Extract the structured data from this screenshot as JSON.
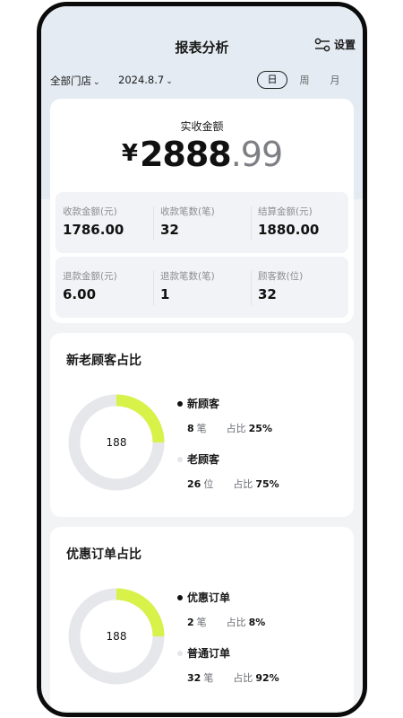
{
  "header": {
    "title": "报表分析",
    "settings_label": "设置"
  },
  "filters": {
    "store": "全部门店",
    "date": "2024.8.7",
    "periods": [
      "日",
      "周",
      "月"
    ],
    "selected_period": "日"
  },
  "summary": {
    "label": "实收金额",
    "currency": "¥",
    "amount_int": "2888",
    "amount_dec": ".99"
  },
  "stats_row1": [
    {
      "label": "收款金额(元)",
      "value": "1786.00"
    },
    {
      "label": "收款笔数(笔)",
      "value": "32"
    },
    {
      "label": "结算金额(元)",
      "value": "1880.00"
    }
  ],
  "stats_row2": [
    {
      "label": "退款金额(元)",
      "value": "6.00"
    },
    {
      "label": "退款笔数(笔)",
      "value": "1"
    },
    {
      "label": "顾客数(位)",
      "value": "32"
    }
  ],
  "customer_ratio": {
    "title": "新老顾客占比",
    "center": "188",
    "items": [
      {
        "name": "新顾客",
        "count": "8",
        "unit": "笔",
        "percent_label": "占比",
        "percent": "25%"
      },
      {
        "name": "老顾客",
        "count": "26",
        "unit": "位",
        "percent_label": "占比",
        "percent": "75%"
      }
    ],
    "highlight_fraction": 0.25
  },
  "order_ratio": {
    "title": "优惠订单占比",
    "center": "188",
    "items": [
      {
        "name": "优惠订单",
        "count": "2",
        "unit": "笔",
        "percent_label": "占比",
        "percent": "8%"
      },
      {
        "name": "普通订单",
        "count": "32",
        "unit": "笔",
        "percent_label": "占比",
        "percent": "92%"
      }
    ],
    "highlight_fraction": 0.25
  },
  "colors": {
    "accent": "#d8f24a",
    "ring": "#e6e7ea",
    "dark": "#111111"
  }
}
